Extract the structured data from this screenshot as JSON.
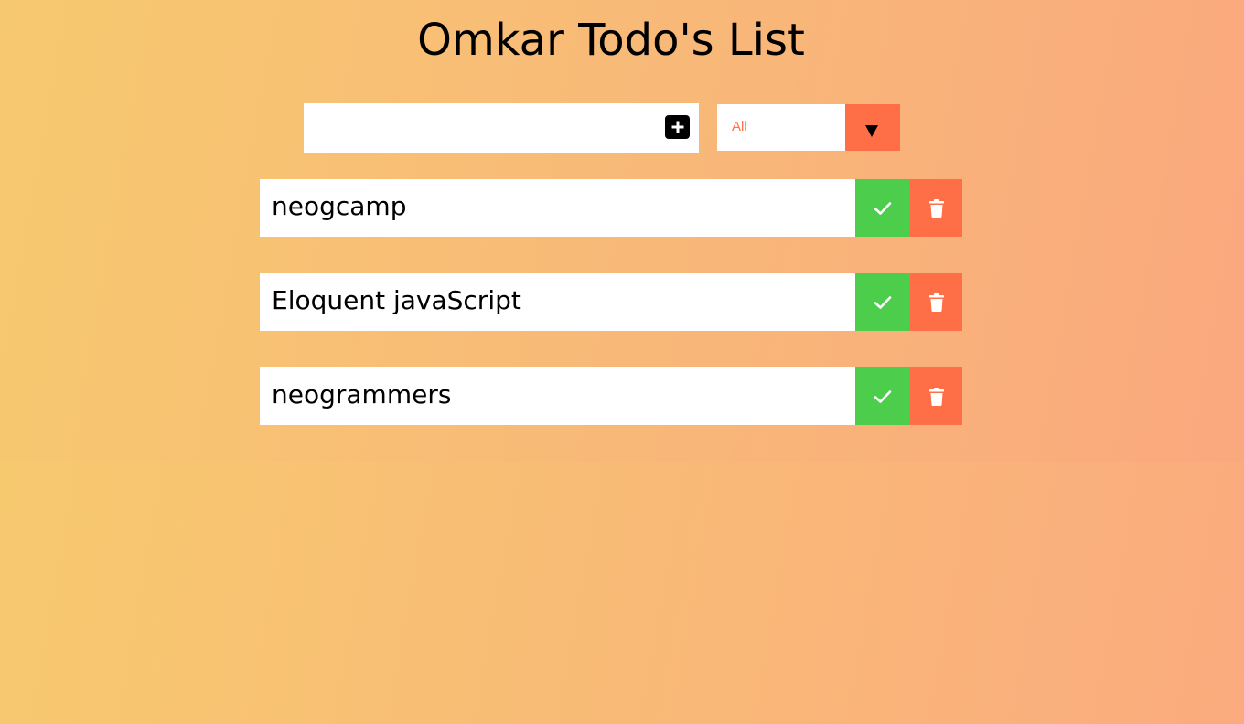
{
  "app": {
    "title": "Omkar Todo's List"
  },
  "input": {
    "value": "",
    "placeholder": ""
  },
  "filter": {
    "selected": "All"
  },
  "todos": [
    {
      "text": "neogcamp"
    },
    {
      "text": "Eloquent javaScript"
    },
    {
      "text": "neogrammers"
    }
  ],
  "icons": {
    "add": "plus-square-icon",
    "filter": "caret-down-icon",
    "complete": "check-icon",
    "delete": "trash-icon"
  },
  "colors": {
    "accent": "#ff6f47",
    "complete": "#4ccd4c",
    "gradient_start": "#f7cb6e",
    "gradient_end": "#fbab7e"
  }
}
